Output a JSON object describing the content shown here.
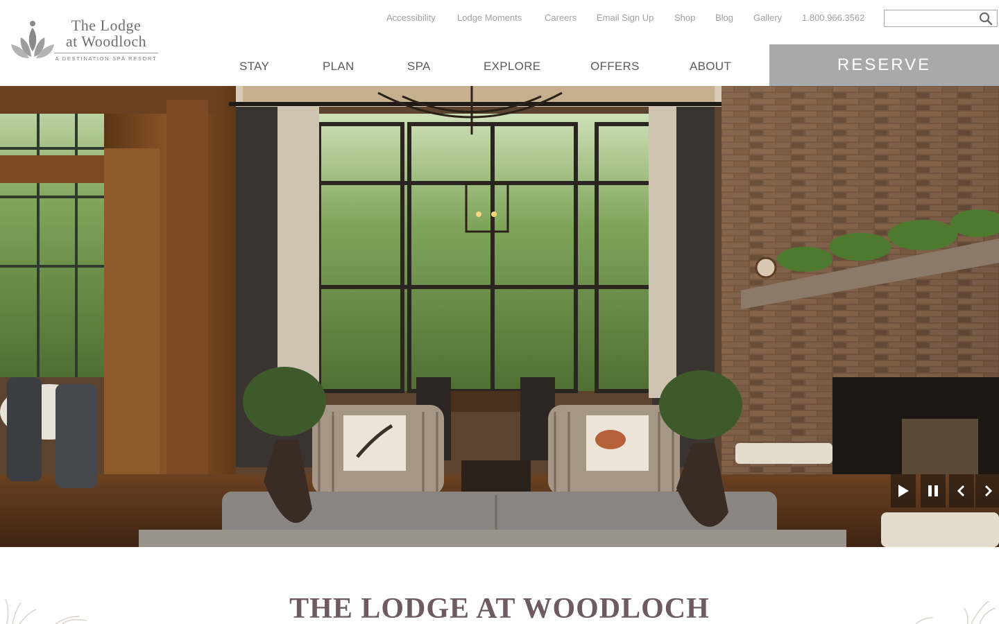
{
  "logo": {
    "line1": "The Lodge",
    "line2": "at Woodloch",
    "line3": "A DESTINATION SPA RESORT",
    "icon": "lotus-icon"
  },
  "utility_nav": [
    {
      "label": "Accessibility"
    },
    {
      "label": "Lodge Moments"
    },
    {
      "label": "Careers"
    },
    {
      "label": "Email Sign Up"
    },
    {
      "label": "Shop"
    },
    {
      "label": "Blog"
    },
    {
      "label": "Gallery"
    },
    {
      "label": "1.800.966.3562"
    }
  ],
  "search": {
    "placeholder": "",
    "value": "",
    "icon": "search-icon"
  },
  "main_nav": [
    {
      "label": "STAY"
    },
    {
      "label": "PLAN"
    },
    {
      "label": "SPA"
    },
    {
      "label": "EXPLORE"
    },
    {
      "label": "OFFERS"
    },
    {
      "label": "ABOUT"
    }
  ],
  "reserve": {
    "label": "RESERVE"
  },
  "hero": {
    "controls": [
      "play-icon",
      "pause-icon",
      "chevron-left-icon",
      "chevron-right-icon"
    ]
  },
  "intro": {
    "title": "THE LODGE AT WOODLOCH"
  },
  "colors": {
    "reserve_bg": "#a9a9a9",
    "title": "#6d5a62",
    "utility_text": "#a0a0a0",
    "nav_text": "#5a5a5a"
  }
}
